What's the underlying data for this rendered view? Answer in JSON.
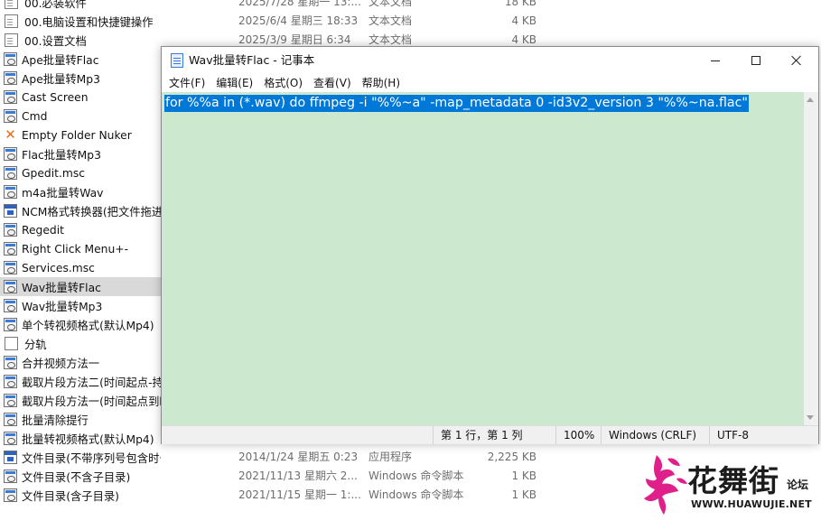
{
  "explorer": {
    "files": [
      {
        "name": "00.必装软件",
        "date": "2025/7/28 星期一 13:...",
        "type": "文本文档",
        "size": "18 KB",
        "icon": "text-file-icon"
      },
      {
        "name": "00.电脑设置和快捷键操作",
        "date": "2025/6/4 星期三 18:33",
        "type": "文本文档",
        "size": "4 KB",
        "icon": "text-file-icon"
      },
      {
        "name": "00.设置文档",
        "date": "2025/3/9 星期日 6:34",
        "type": "文本文档",
        "size": "4 KB",
        "icon": "text-file-icon"
      },
      {
        "name": "Ape批量转Flac",
        "date": "",
        "type": "",
        "size": "",
        "icon": "batch-file-icon"
      },
      {
        "name": "Ape批量转Mp3",
        "date": "",
        "type": "",
        "size": "",
        "icon": "batch-file-icon"
      },
      {
        "name": "Cast Screen",
        "date": "",
        "type": "",
        "size": "",
        "icon": "batch-file-icon"
      },
      {
        "name": "Cmd",
        "date": "",
        "type": "",
        "size": "",
        "icon": "batch-file-icon"
      },
      {
        "name": "Empty Folder Nuker",
        "date": "",
        "type": "",
        "size": "",
        "icon": "empty-folder-nuker-icon"
      },
      {
        "name": "Flac批量转Mp3",
        "date": "",
        "type": "",
        "size": "",
        "icon": "batch-file-icon"
      },
      {
        "name": "Gpedit.msc",
        "date": "",
        "type": "",
        "size": "",
        "icon": "batch-file-icon"
      },
      {
        "name": "m4a批量转Wav",
        "date": "",
        "type": "",
        "size": "",
        "icon": "batch-file-icon"
      },
      {
        "name": "NCM格式转换器(把文件拖进",
        "date": "",
        "type": "",
        "size": "",
        "icon": "application-icon"
      },
      {
        "name": "Regedit",
        "date": "",
        "type": "",
        "size": "",
        "icon": "batch-file-icon"
      },
      {
        "name": "Right Click Menu+-",
        "date": "",
        "type": "",
        "size": "",
        "icon": "batch-file-icon"
      },
      {
        "name": "Services.msc",
        "date": "",
        "type": "",
        "size": "",
        "icon": "batch-file-icon"
      },
      {
        "name": "Wav批量转Flac",
        "date": "",
        "type": "",
        "size": "",
        "icon": "batch-file-icon",
        "selected": true
      },
      {
        "name": "Wav批量转Mp3",
        "date": "",
        "type": "",
        "size": "",
        "icon": "batch-file-icon"
      },
      {
        "name": "单个转视频格式(默认Mp4)",
        "date": "",
        "type": "",
        "size": "",
        "icon": "batch-file-icon"
      },
      {
        "name": "分轨",
        "date": "",
        "type": "",
        "size": "",
        "icon": "blank-file-icon"
      },
      {
        "name": "合并视频方法一",
        "date": "",
        "type": "",
        "size": "",
        "icon": "batch-file-icon"
      },
      {
        "name": "截取片段方法二(时间起点-持",
        "date": "",
        "type": "",
        "size": "",
        "icon": "batch-file-icon"
      },
      {
        "name": "截取片段方法一(时间起点到时",
        "date": "",
        "type": "",
        "size": "",
        "icon": "batch-file-icon"
      },
      {
        "name": "批量清除提行",
        "date": "",
        "type": "",
        "size": "",
        "icon": "batch-file-icon"
      },
      {
        "name": "批量转视频格式(默认Mp4)",
        "date": "",
        "type": "",
        "size": "",
        "icon": "batch-file-icon"
      },
      {
        "name": "文件目录(不带序列号包含时长大小)",
        "date": "2014/1/24 星期五 0:23",
        "type": "应用程序",
        "size": "2,225 KB",
        "icon": "application-icon"
      },
      {
        "name": "文件目录(不含子目录)",
        "date": "2021/11/13 星期六 2...",
        "type": "Windows 命令脚本",
        "size": "1 KB",
        "icon": "batch-file-icon"
      },
      {
        "name": "文件目录(含子目录)",
        "date": "2021/11/15 星期一 1:...",
        "type": "Windows 命令脚本",
        "size": "1 KB",
        "icon": "batch-file-icon"
      }
    ]
  },
  "notepad": {
    "title": "Wav批量转Flac - 记事本",
    "menu": [
      "文件(F)",
      "编辑(E)",
      "格式(O)",
      "查看(V)",
      "帮助(H)"
    ],
    "content": "for %%a in (*.wav) do ffmpeg -i \"%%~a\" -map_metadata 0 -id3v2_version 3 \"%%~na.flac\"",
    "status": {
      "position": "第 1 行，第 1 列",
      "zoom": "100%",
      "line_ending": "Windows (CRLF)",
      "encoding": "UTF-8"
    },
    "colors": {
      "editor_bg": "#cce8cf",
      "selection": "#0078d7"
    }
  },
  "watermark": {
    "chinese": "花舞街",
    "suffix": "论坛",
    "url": "WWW.HUAWUJIE.NET",
    "accent": "#e0208a"
  }
}
